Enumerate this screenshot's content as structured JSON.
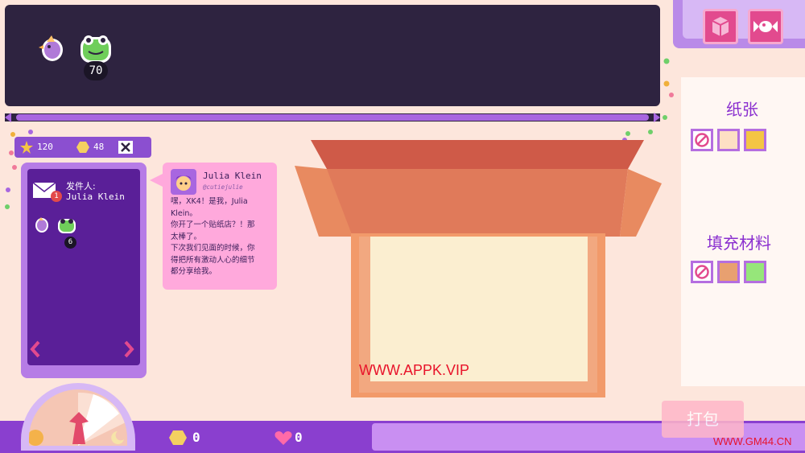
{
  "shelf": {
    "items": [
      {
        "icon": "purple-bird-sticker-icon"
      },
      {
        "icon": "green-frog-sticker-icon",
        "count": "70"
      }
    ]
  },
  "tools": [
    {
      "icon": "box-icon"
    },
    {
      "icon": "candy-icon"
    }
  ],
  "stats": {
    "stars": "120",
    "coins": "48"
  },
  "letter": {
    "sender_label": "发件人:",
    "sender_name": "Julia Klein",
    "mail_badge": "1",
    "items": [
      {
        "icon": "purple-bird-sticker-icon"
      },
      {
        "icon": "green-frog-sticker-icon",
        "count": "6"
      }
    ]
  },
  "message": {
    "name": "Julia Klein",
    "handle": "@cutiejulie",
    "lines": [
      "嘿，XK4！是我，Julia",
      "Klein。",
      "你开了一个贴纸店？！那",
      "太棒了。",
      "下次我们见面的时候，你",
      "得把所有激动人心的细节",
      "都分享给我。"
    ]
  },
  "right_panel": {
    "paper_title": "纸张",
    "paper_swatches": [
      "none",
      "#fde0c4",
      "#f4c544"
    ],
    "filler_title": "填充材料",
    "filler_swatches": [
      "none",
      "#e8a070",
      "#96e67a"
    ]
  },
  "bottom": {
    "coins": "0",
    "hearts": "0",
    "pack_label": "打包"
  },
  "watermarks": {
    "center": "WWW.APPK.VIP",
    "corner": "WWW.GM44.CN"
  },
  "colors": {
    "accent": "#8a3fcf",
    "pink": "#e24a8e",
    "box": "#e07a5a"
  }
}
